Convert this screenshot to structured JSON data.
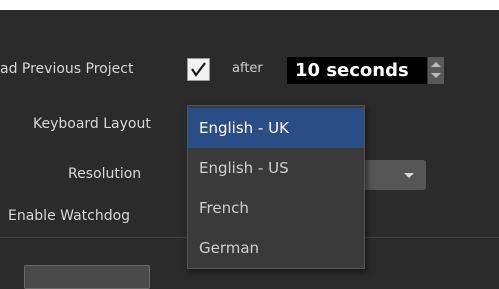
{
  "settings": {
    "load_previous_project_label": "ad Previous Project",
    "load_previous_checked": true,
    "after_label": "after",
    "delay_value": "10 seconds",
    "keyboard_layout_label": "Keyboard Layout",
    "resolution_label": "Resolution",
    "enable_watchdog_label": "Enable Watchdog"
  },
  "keyboard_dropdown": {
    "options": [
      "English - UK",
      "English - US",
      "French",
      "German"
    ],
    "selected": "English - UK"
  },
  "colors": {
    "background": "#2b2b2b",
    "selected_option": "#2b4d86",
    "dropdown_bg": "#3a3a3a",
    "value_box": "#000000"
  },
  "icons": [
    "checkmark-icon",
    "spinner-up-icon",
    "spinner-down-icon",
    "dropdown-caret-icon"
  ]
}
